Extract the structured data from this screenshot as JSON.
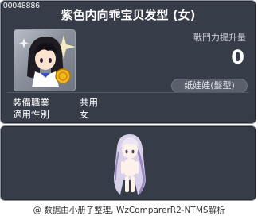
{
  "item": {
    "id": "00048886",
    "title": "紫色内向乖宝贝发型 (女)",
    "power_label": "戰鬥力提升量",
    "power_value": "0",
    "category": "纸娃娃(髮型)"
  },
  "stats": [
    {
      "label": "裝備職業",
      "value": "共用"
    },
    {
      "label": "適用性別",
      "value": "女"
    }
  ],
  "footer": {
    "credit_icon": "copyright-icon",
    "credit_symbol": "@",
    "credit_text": "数据由小册子整理, WzComparerR2-NTMS解析"
  },
  "colors": {
    "panel_bg": "#363c48",
    "panel_border": "#8c929c",
    "text": "#ffffff",
    "hair": "#d8d0e8",
    "hair_shade": "#9a88c0"
  }
}
